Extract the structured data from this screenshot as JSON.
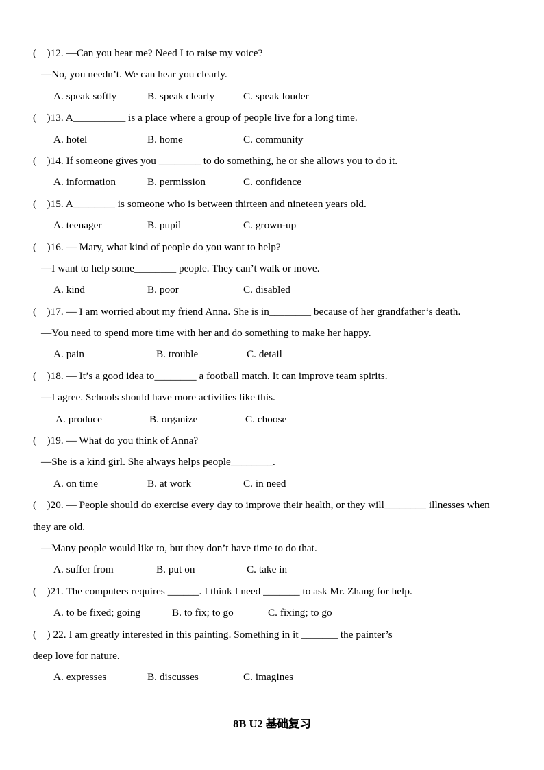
{
  "document": {
    "footer_heading": "8B U2 基础复习"
  },
  "questions": [
    {
      "number": "12",
      "marker": "(    )12.",
      "stem_pre": " —Can you hear me? Need I to ",
      "stem_underlined": "raise my voice",
      "stem_post": "?",
      "reply": "—No, you needn’t. We can hear you clearly.",
      "options": [
        "A. speak softly",
        "B. speak clearly",
        "C. speak louder"
      ]
    },
    {
      "number": "13",
      "marker": "(    )13.",
      "stem": " A__________ is a place where a group of people live for a long time.",
      "options": [
        "A. hotel",
        "B. home",
        "C. community"
      ]
    },
    {
      "number": "14",
      "marker": "(    )14.",
      "stem": " If someone gives you ________ to do something, he or she allows you to do it.",
      "options": [
        "A. information",
        "B. permission",
        "C. confidence"
      ]
    },
    {
      "number": "15",
      "marker": "(    )15.",
      "stem": " A________ is someone who is between thirteen and nineteen years old.",
      "options": [
        "A. teenager",
        "B. pupil",
        "C. grown-up"
      ]
    },
    {
      "number": "16",
      "marker": "(    )16.",
      "stem": " — Mary, what kind of people do you want to help?",
      "reply": "—I want to help some________ people. They can’t walk or move.",
      "options": [
        "A. kind",
        "B. poor",
        "C. disabled"
      ]
    },
    {
      "number": "17",
      "marker": "(    )17.",
      "stem": " — I am worried about my friend Anna. She is in________ because of her grandfather’s death.",
      "reply": "—You need to spend more time with her and do something to make her happy.",
      "options": [
        "A. pain",
        "B. trouble",
        "C. detail"
      ]
    },
    {
      "number": "18",
      "marker": "(    )18.",
      "stem": " — It’s a good idea to________ a football match. It can improve team spirits.",
      "reply": "—I agree. Schools should have more activities like this.",
      "options": [
        "A. produce",
        "B. organize",
        "C. choose"
      ]
    },
    {
      "number": "19",
      "marker": "(    )19.",
      "stem": " — What do you think of Anna?",
      "reply": "—She is a kind girl. She always helps people________.",
      "options": [
        "A. on time",
        "B. at work",
        "C. in need"
      ]
    },
    {
      "number": "20",
      "marker": "(    )20.",
      "stem": " — People should do exercise every day to improve their health, or they will________ illnesses when",
      "stem_cont": "they are old.",
      "reply": "—Many people would like to, but they don’t have time to do that.",
      "options": [
        "A. suffer from",
        "B. put on",
        "C. take in"
      ]
    },
    {
      "number": "21",
      "marker": "(    )21.",
      "stem": " The computers requires ______. I think I need _______ to ask Mr. Zhang for help.",
      "options": [
        "A. to be fixed; going",
        "B. to fix; to go",
        "C. fixing; to go"
      ]
    },
    {
      "number": "22",
      "marker": "(    ) 22.",
      "stem": " I am greatly interested in this painting. Something in it _______ the painter’s",
      "stem_cont": "deep love for nature.",
      "options": [
        "A. expresses",
        "B. discusses",
        "C. imagines"
      ]
    }
  ]
}
